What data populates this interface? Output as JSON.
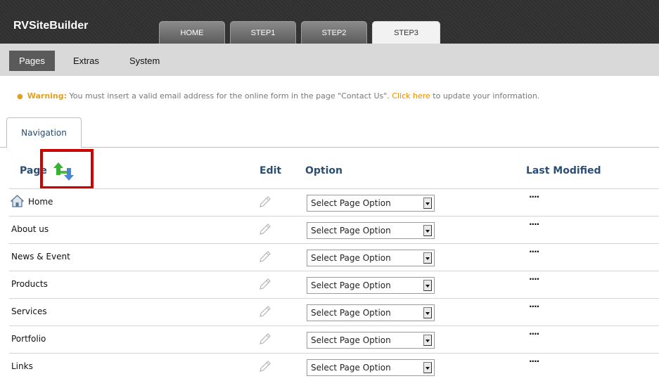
{
  "app": {
    "title": "RVSiteBuilder"
  },
  "top_tabs": [
    {
      "label": "HOME"
    },
    {
      "label": "STEP1"
    },
    {
      "label": "STEP2"
    },
    {
      "label": "STEP3",
      "active": true
    }
  ],
  "subnav": [
    {
      "label": "Pages",
      "active": true
    },
    {
      "label": "Extras"
    },
    {
      "label": "System"
    }
  ],
  "warning": {
    "label": "Warning:",
    "text": " You must insert a valid email address for the online form in the page \"Contact Us\". ",
    "link": "Click here",
    "suffix": " to update your information."
  },
  "navigation_tab": {
    "label": "Navigation"
  },
  "table": {
    "headers": {
      "page": "Page",
      "edit": "Edit",
      "option": "Option",
      "last_modified": "Last Modified"
    },
    "rows": [
      {
        "name": "Home",
        "option": "Select Page Option",
        "last_modified": "····"
      },
      {
        "name": "About us",
        "option": "Select Page Option",
        "last_modified": "····"
      },
      {
        "name": "News & Event",
        "option": "Select Page Option",
        "last_modified": "····"
      },
      {
        "name": "Products",
        "option": "Select Page Option",
        "last_modified": "····"
      },
      {
        "name": "Services",
        "option": "Select Page Option",
        "last_modified": "····"
      },
      {
        "name": "Portfolio",
        "option": "Select Page Option",
        "last_modified": "····"
      },
      {
        "name": "Links",
        "option": "Select Page Option",
        "last_modified": "····"
      }
    ]
  },
  "icons": {
    "sort": "sort-up-down-icon",
    "edit": "pencil-icon",
    "home": "home-icon",
    "dropdown": "chevron-down-icon"
  },
  "colors": {
    "topbar": "#2f2f2f",
    "header_text": "#2b4f74",
    "warning_accent": "#e0a020",
    "link": "#f08a00",
    "highlight_box": "#cc0000",
    "sort_up": "#3cb034",
    "sort_down": "#4a86d8"
  }
}
